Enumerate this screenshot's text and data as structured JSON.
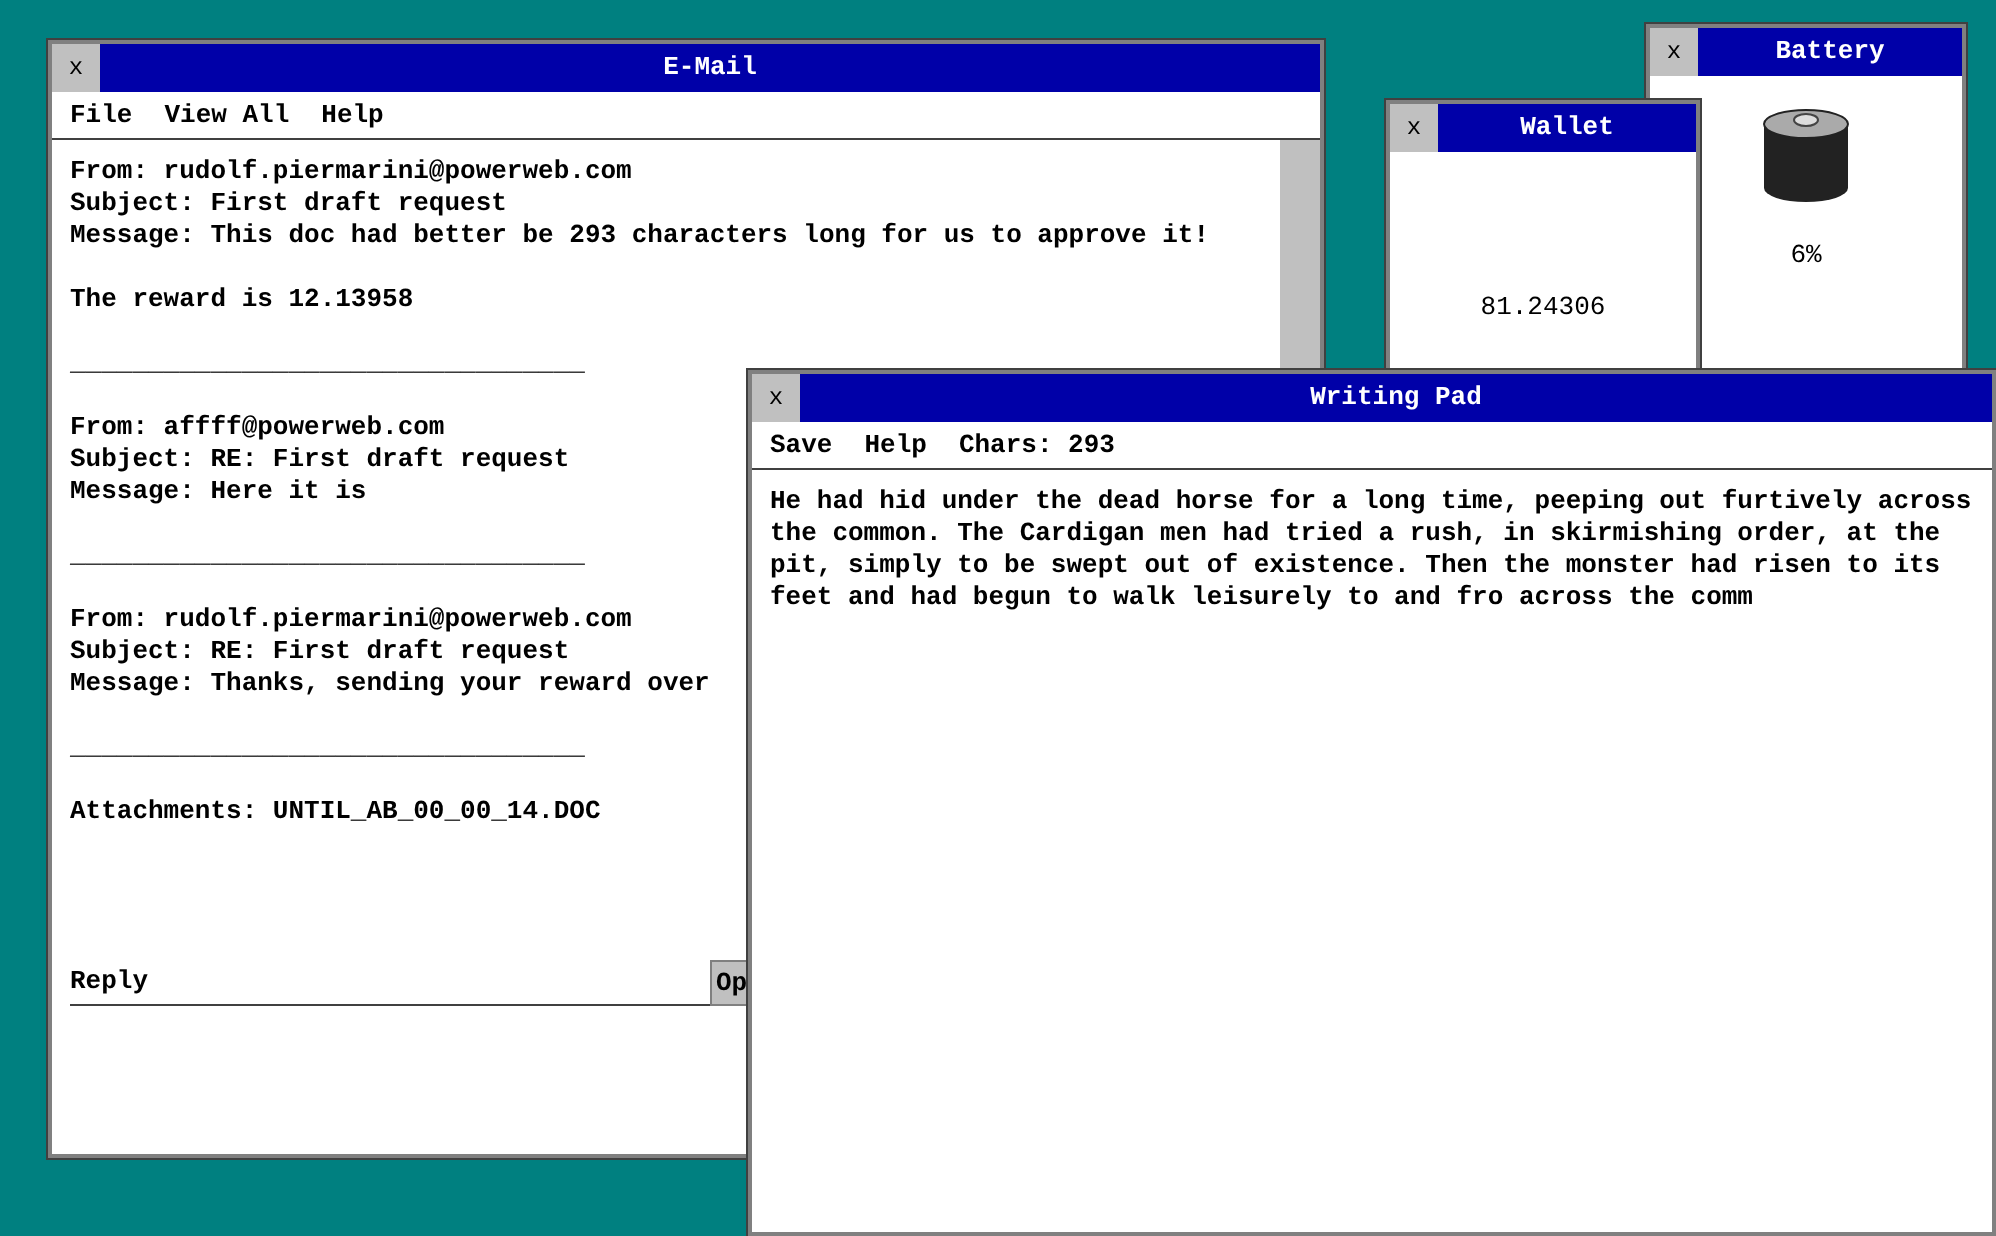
{
  "email": {
    "title": "E-Mail",
    "close": "x",
    "menu": [
      "File",
      "View All",
      "Help"
    ],
    "body": [
      [
        "From: rudolf.piermarini@powerweb.com",
        "Subject: First draft request",
        "Message: This doc had better be 293 characters long for us to approve it!"
      ],
      [
        "The reward is 12.13958"
      ],
      [
        "_________________________________"
      ],
      [
        "From: affff@powerweb.com",
        "Subject: RE: First draft request",
        "Message: Here it is"
      ],
      [
        "_________________________________"
      ],
      [
        "From: rudolf.piermarini@powerweb.com",
        "Subject: RE: First draft request",
        "Message: Thanks, sending your reward over"
      ],
      [
        "_________________________________"
      ],
      [
        "Attachments: UNTIL_AB_00_00_14.DOC"
      ]
    ],
    "reply_label": "Reply",
    "button": "Op"
  },
  "battery": {
    "title": "Battery",
    "close": "x",
    "reading": "6%"
  },
  "wallet": {
    "title": "Wallet",
    "close": "x",
    "amount": "81.24306"
  },
  "writing_pad": {
    "title": "Writing Pad",
    "close": "x",
    "menu": [
      "Save",
      "Help"
    ],
    "chars": "Chars: 293",
    "text": "He had hid under the dead horse for a long time, peeping out furtively across the common. The Cardigan men had tried a rush, in skirmishing order, at the pit, simply to be swept out of existence. Then the monster had risen to its feet and had begun to walk leisurely to and fro across the comm"
  }
}
